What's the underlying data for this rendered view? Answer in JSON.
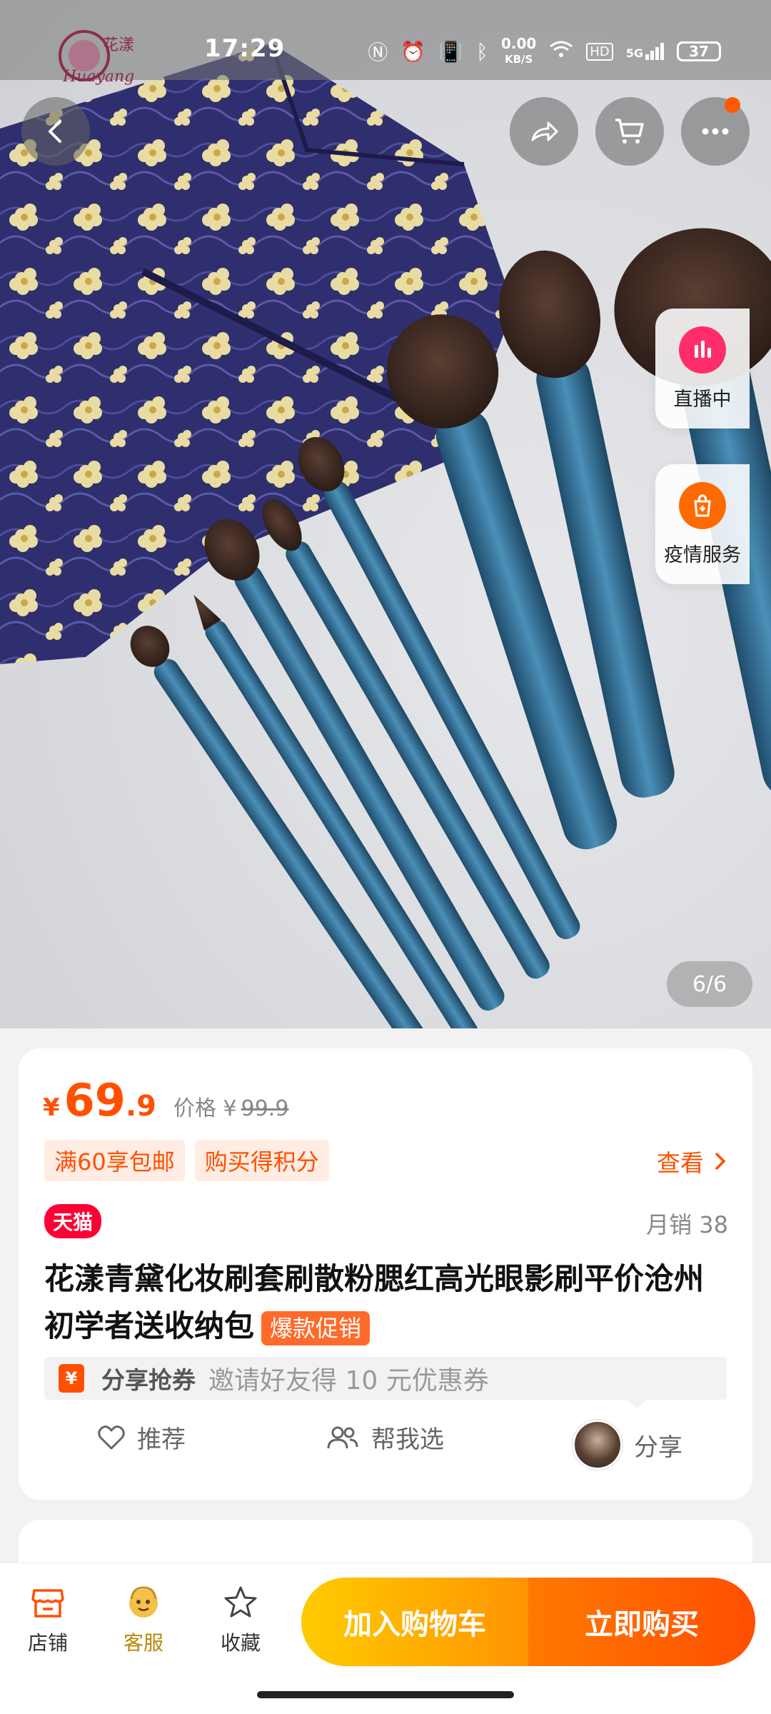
{
  "status_bar": {
    "time": "17:29",
    "net_speed": "0.00",
    "net_unit": "KB/S",
    "hd": "HD",
    "signal": "5G",
    "battery": "37"
  },
  "brand_logo": {
    "text": "Huayang",
    "chars": "花漾"
  },
  "nav": {
    "back_icon": "chevron-left-icon",
    "share_icon": "share-arrow-icon",
    "cart_icon": "cart-icon",
    "more_icon": "more-dots-icon"
  },
  "floating": {
    "live_label": "直播中",
    "service_label": "疫情服务"
  },
  "gallery": {
    "counter": "6/6"
  },
  "product": {
    "currency": "¥",
    "price_int": "69",
    "price_dec": ".9",
    "orig_label": "价格 ¥",
    "orig_price": "99.9",
    "tags": [
      "满60享包邮",
      "购买得积分"
    ],
    "view_label": "查看",
    "platform_badge": "天猫",
    "monthly_sales": "月销 38",
    "title": "花漾青黛化妆刷套刷散粉腮红高光眼影刷平价沧州初学者送收纳包",
    "hot_badge": "爆款促销",
    "share_coupon": {
      "icon_text": "¥",
      "label": "分享抢券",
      "desc": "邀请好友得 10 元优惠券"
    },
    "actions": {
      "recommend": "推荐",
      "help_choose": "帮我选",
      "share": "分享"
    }
  },
  "bottom_bar": {
    "shop": "店铺",
    "service": "客服",
    "favorite": "收藏",
    "add_to_cart": "加入购物车",
    "buy_now": "立即购买"
  },
  "colors": {
    "accent": "#ff5000",
    "tmall": "#ff0036",
    "cart_button": "#ffb000",
    "buy_button": "#ff5a00",
    "brush_handle": "#2f6a8f",
    "pouch": "#2f2e6e"
  }
}
